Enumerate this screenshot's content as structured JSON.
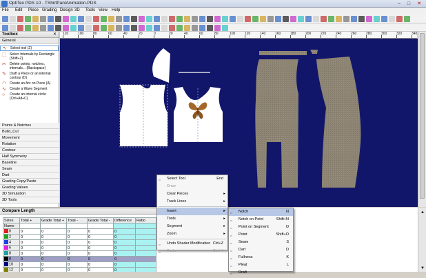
{
  "window": {
    "title": "OptiTex PDS 10 - TShirtPantAnimation.PDS"
  },
  "menu": {
    "items": [
      "File",
      "Edit",
      "Piece",
      "Grading",
      "Design",
      "3D",
      "Tools",
      "View",
      "Help"
    ]
  },
  "ruler": {
    "ticks": [
      "120",
      "100",
      "80",
      "60",
      "40",
      "20",
      "0",
      "20",
      "40",
      "60",
      "80",
      "100",
      "120",
      "140",
      "160",
      "180",
      "200",
      "220",
      "240",
      "260",
      "280",
      "300",
      "320",
      "340"
    ]
  },
  "toolbox": {
    "title": "Toolbox",
    "section": "General",
    "items": [
      {
        "label": "Select tool (Z)",
        "icon": "arrow-select-icon",
        "selected": true
      },
      {
        "label": "Select Internals by Rectangle (Shift+Z)",
        "icon": "rect-select-icon"
      },
      {
        "label": "Delete points, notches, internals... (Backspace)",
        "icon": "delete-points-icon"
      },
      {
        "label": "Draft a Piece or an internal contour (D)",
        "icon": "draft-icon"
      },
      {
        "label": "Create an Arc on Piece (A)",
        "icon": "arc-icon"
      },
      {
        "label": "Create a Wave Segment",
        "icon": "wave-icon"
      },
      {
        "label": "Create an internal circle (Ctrl+Alt+C)",
        "icon": "circle-icon"
      }
    ],
    "categories": [
      "Points & Notches",
      "Build_Cut",
      "Movement",
      "Rotation",
      "Contour",
      "Half Symmetry",
      "Baseline",
      "Seam",
      "Dart",
      "Grading Copy/Paste",
      "Grading Values",
      "3D Simulation",
      "3D Tools"
    ]
  },
  "compare": {
    "title": "Compare Length",
    "columns": [
      "Sizes",
      "Total +",
      "Grade Total +",
      "Total -",
      "Grade Total -",
      "Difference",
      "Ratio"
    ],
    "rows": [
      {
        "size": "Name",
        "color": "",
        "vals": [
          "",
          "",
          "",
          "",
          "",
          ""
        ]
      },
      {
        "size": "0",
        "color": "#e02020",
        "vals": [
          "0",
          "0",
          "0",
          "0",
          "0",
          ""
        ]
      },
      {
        "size": "2",
        "color": "#20a020",
        "vals": [
          "0",
          "0",
          "0",
          "0",
          "0",
          ""
        ]
      },
      {
        "size": "4",
        "color": "#2040e0",
        "vals": [
          "0",
          "0",
          "0",
          "0",
          "0",
          ""
        ]
      },
      {
        "size": "6",
        "color": "#e020e0",
        "vals": [
          "0",
          "0",
          "0",
          "0",
          "0",
          ""
        ]
      },
      {
        "size": "8",
        "color": "#20a0a0",
        "vals": [
          "0",
          "0",
          "0",
          "0",
          "0",
          ""
        ]
      },
      {
        "size": "8",
        "color": "#000000",
        "vals": [
          "0",
          "0",
          "0",
          "0",
          "0",
          ""
        ],
        "highlight": true
      },
      {
        "size": "10",
        "color": "#000080",
        "vals": [
          "0",
          "0",
          "0",
          "0",
          "0",
          ""
        ]
      },
      {
        "size": "12",
        "color": "#808000",
        "vals": [
          "0",
          "0",
          "0",
          "0",
          "0",
          ""
        ]
      }
    ]
  },
  "context_menu": {
    "items": [
      {
        "label": "Select Tool",
        "shortcut": "End",
        "icon": "select-tool-icon"
      },
      {
        "label": "Draw",
        "disabled": true
      },
      {
        "label": "Clear Pieces",
        "arrow": true
      },
      {
        "label": "Track Lines",
        "arrow": true
      },
      {
        "sep": true
      },
      {
        "label": "Insert",
        "arrow": true,
        "active": true
      },
      {
        "label": "Tools",
        "arrow": true
      },
      {
        "label": "Segment",
        "arrow": true
      },
      {
        "label": "Zoom",
        "arrow": true
      },
      {
        "sep": true
      },
      {
        "label": "Undo Shader Modification",
        "shortcut": "Ctrl+Z",
        "icon": "undo-icon"
      },
      {
        "label": "Redo",
        "shortcut": "Ctrl+Y",
        "disabled": true,
        "icon": "redo-icon"
      }
    ]
  },
  "insert_submenu": {
    "items": [
      {
        "label": "Notch",
        "shortcut": "N",
        "active": true,
        "icon": "notch-icon"
      },
      {
        "label": "Notch on Point",
        "shortcut": "Shift+N",
        "icon": "notch-point-icon"
      },
      {
        "label": "Point on Segment",
        "shortcut": "O",
        "icon": "point-segment-icon"
      },
      {
        "label": "Point",
        "shortcut": "Shift+O",
        "icon": "point-icon"
      },
      {
        "label": "Seam",
        "shortcut": "S",
        "icon": "seam-icon"
      },
      {
        "label": "Dart",
        "shortcut": "D",
        "icon": "dart-icon"
      },
      {
        "label": "Fullness",
        "shortcut": "K",
        "icon": "fullness-icon"
      },
      {
        "label": "Pleat",
        "shortcut": "L",
        "icon": "pleat-icon"
      },
      {
        "label": "Draft",
        "shortcut": "",
        "icon": "draft-icon"
      }
    ]
  },
  "colors": {
    "canvas": "#12166a",
    "fabric": "#8d8474",
    "highlight": "#b7c7e6"
  }
}
